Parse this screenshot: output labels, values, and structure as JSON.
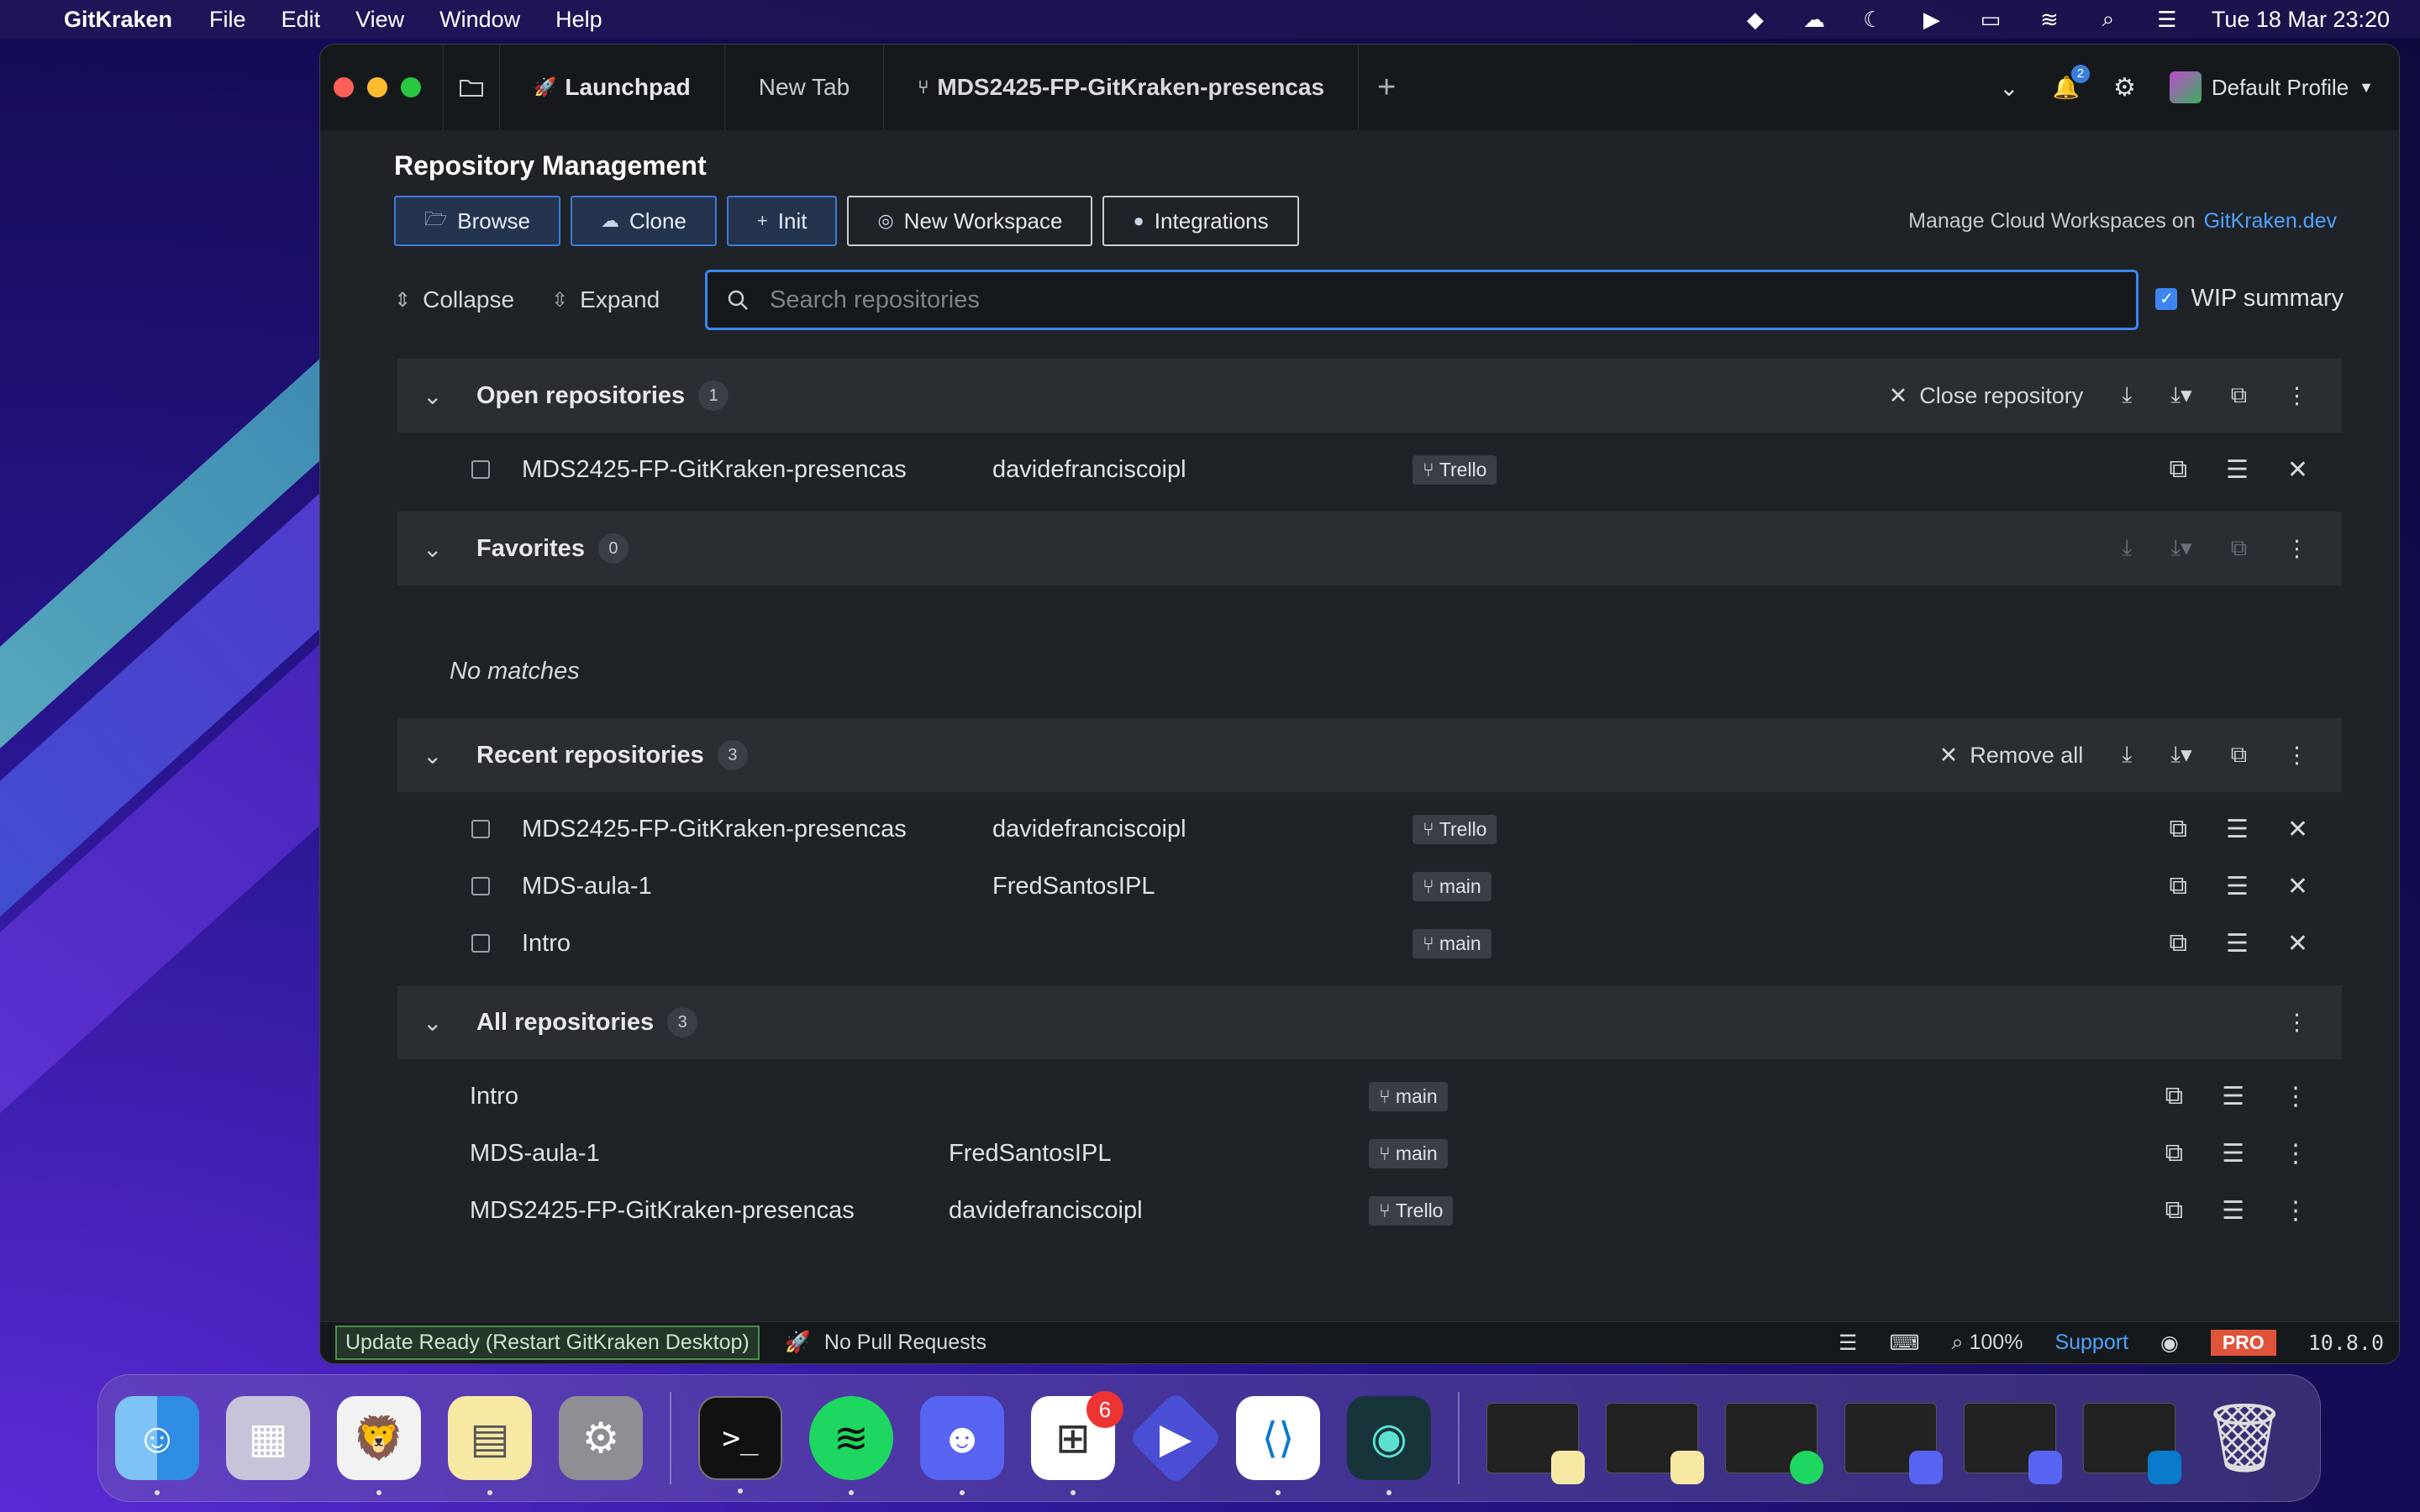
{
  "menubar": {
    "app_name": "GitKraken",
    "items": [
      "File",
      "Edit",
      "View",
      "Window",
      "Help"
    ],
    "datetime": "Tue 18 Mar  23:20"
  },
  "tabs": {
    "launchpad": "Launchpad",
    "new_tab": "New Tab",
    "repo_tab": "MDS2425-FP-GitKraken-presencas",
    "notification_count": "2",
    "profile": "Default Profile"
  },
  "page": {
    "title": "Repository Management",
    "buttons": {
      "browse": "Browse",
      "clone": "Clone",
      "init": "Init",
      "new_workspace": "New Workspace",
      "integrations": "Integrations"
    },
    "cloud_text": "Manage Cloud Workspaces on",
    "cloud_link": "GitKraken.dev",
    "collapse": "Collapse",
    "expand": "Expand",
    "search_placeholder": "Search repositories",
    "wip_summary": "WIP summary"
  },
  "open_repos": {
    "title": "Open repositories",
    "count": "1",
    "close_label": "Close repository",
    "rows": [
      {
        "name": "MDS2425-FP-GitKraken-presencas",
        "owner": "davidefranciscoipl",
        "branch": "Trello"
      }
    ]
  },
  "favorites": {
    "title": "Favorites",
    "count": "0",
    "empty": "No matches"
  },
  "recent_repos": {
    "title": "Recent repositories",
    "count": "3",
    "remove_label": "Remove all",
    "rows": [
      {
        "name": "MDS2425-FP-GitKraken-presencas",
        "owner": "davidefranciscoipl",
        "branch": "Trello"
      },
      {
        "name": "MDS-aula-1",
        "owner": "FredSantosIPL",
        "branch": "main"
      },
      {
        "name": "Intro",
        "owner": "",
        "branch": "main"
      }
    ]
  },
  "all_repos": {
    "title": "All repositories",
    "count": "3",
    "rows": [
      {
        "name": "Intro",
        "owner": "",
        "branch": "main"
      },
      {
        "name": "MDS-aula-1",
        "owner": "FredSantosIPL",
        "branch": "main"
      },
      {
        "name": "MDS2425-FP-GitKraken-presencas",
        "owner": "davidefranciscoipl",
        "branch": "Trello"
      }
    ]
  },
  "statusbar": {
    "update": "Update Ready (Restart GitKraken Desktop)",
    "pull_requests": "No Pull Requests",
    "zoom": "100%",
    "support": "Support",
    "pro": "PRO",
    "version": "10.8.0"
  },
  "dock": {
    "store_badge": "6"
  },
  "colors": {
    "accent": "#3d86f0",
    "link": "#4ea3ff",
    "pro": "#e0543b"
  }
}
